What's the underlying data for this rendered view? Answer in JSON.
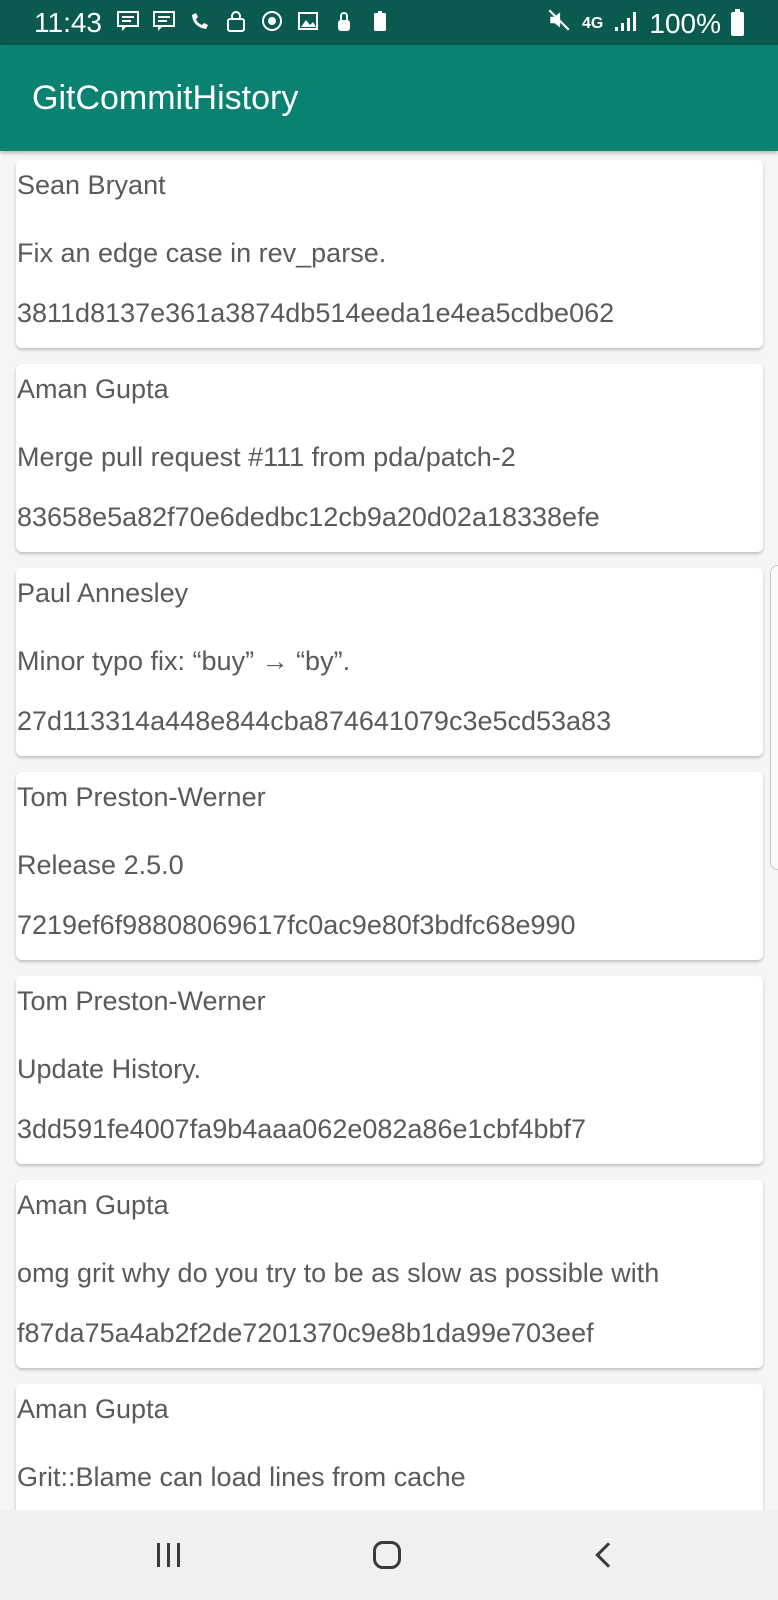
{
  "status_bar": {
    "time": "11:43",
    "battery_percent": "100%",
    "icons": [
      "message-icon",
      "message-icon",
      "wifi-call-icon",
      "lock-icon",
      "sync-icon",
      "image-icon",
      "lock-icon",
      "battery-saver-icon"
    ],
    "right_icons": [
      "mute-icon",
      "lte-4g-icon",
      "signal-icon",
      "battery-icon"
    ],
    "network": "4G"
  },
  "app_bar": {
    "title": "GitCommitHistory",
    "color": "#0a8272",
    "status_color": "#0b5a4f"
  },
  "commits": [
    {
      "author": "Sean Bryant",
      "message": "Fix an edge case in rev_parse.",
      "sha": "3811d8137e361a3874db514eeda1e4ea5cdbe062"
    },
    {
      "author": "Aman Gupta",
      "message": "Merge pull request #111 from pda/patch-2",
      "sha": "83658e5a82f70e6dedbc12cb9a20d02a18338efe"
    },
    {
      "author": "Paul Annesley",
      "message": "Minor typo fix: “buy” → “by”.",
      "sha": "27d113314a448e844cba874641079c3e5cd53a83"
    },
    {
      "author": "Tom Preston-Werner",
      "message": "Release 2.5.0",
      "sha": "7219ef6f98808069617fc0ac9e80f3bdfc68e990"
    },
    {
      "author": "Tom Preston-Werner",
      "message": "Update History.",
      "sha": "3dd591fe4007fa9b4aaa062e082a86e1cbf4bbf7"
    },
    {
      "author": "Aman Gupta",
      "message": "omg grit why do you try to be as slow as possible with everything",
      "sha": "f87da75a4ab2f2de7201370c9e8b1da99e703eef"
    },
    {
      "author": "Aman Gupta",
      "message": "Grit::Blame can load lines from cache",
      "sha": ""
    }
  ],
  "nav_bar": {
    "recents": "recents-icon",
    "home": "home-icon",
    "back": "back-icon"
  }
}
